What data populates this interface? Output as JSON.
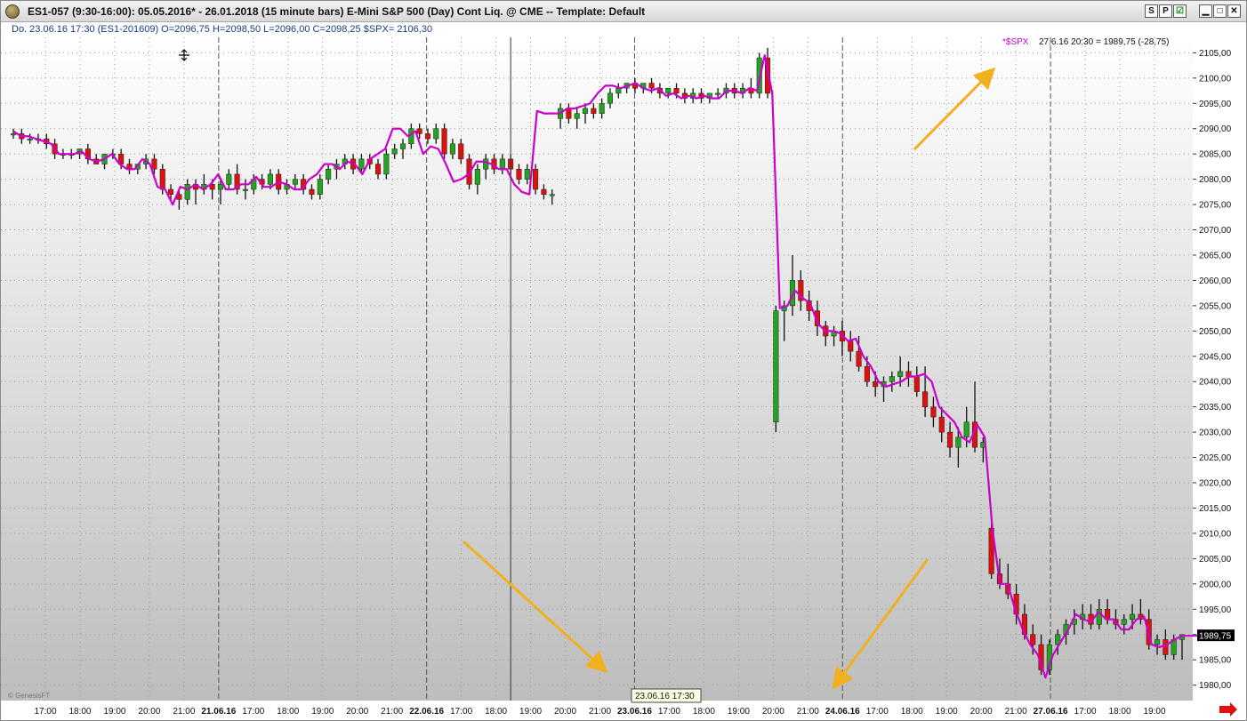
{
  "window": {
    "title": "ES1-057 (9:30-16:00):  05.05.2016* - 26.01.2018  (15 minute bars)   E-Mini S&P 500 (Day) Cont Liq. @ CME  --  Template: Default",
    "buttons": [
      "S",
      "P",
      "☑"
    ]
  },
  "infobar": {
    "text": "Do.   23.06.16 17:30 (ES1-201609)  O=2096,75  H=2098,50  L=2096,00  C=2098,25  $SPX= 2106,30"
  },
  "overlay": {
    "spx_label": "*$SPX",
    "spx_readout": "27.6.16 20:30 = 1989,75 (-28,75)",
    "last_price": "1989,75",
    "cursor_time": "23.06.16 17:30",
    "watermark": "© GenesisFT"
  },
  "colors": {
    "up_candle": "#22a322",
    "down_candle": "#dd1111",
    "spx_line": "#cc00cc",
    "arrow": "#f0b020",
    "axis_text": "#111111"
  },
  "chart_data": {
    "type": "line",
    "title": "",
    "xlabel": "",
    "ylabel": "",
    "ylim": [
      1978,
      2107
    ],
    "y_ticks": [
      "1980,00",
      "1985,00",
      "1990,00",
      "1995,00",
      "2000,00",
      "2005,00",
      "2010,00",
      "2015,00",
      "2020,00",
      "2025,00",
      "2030,00",
      "2035,00",
      "2040,00",
      "2045,00",
      "2050,00",
      "2055,00",
      "2060,00",
      "2065,00",
      "2070,00",
      "2075,00",
      "2080,00",
      "2085,00",
      "2090,00",
      "2095,00",
      "2100,00",
      "2105,00"
    ],
    "x_ticks": [
      {
        "label": "17:00",
        "bold": false
      },
      {
        "label": "18:00",
        "bold": false
      },
      {
        "label": "19:00",
        "bold": false
      },
      {
        "label": "20:00",
        "bold": false
      },
      {
        "label": "21:00",
        "bold": false
      },
      {
        "label": "21.06.16",
        "bold": true
      },
      {
        "label": "17:00",
        "bold": false
      },
      {
        "label": "18:00",
        "bold": false
      },
      {
        "label": "19:00",
        "bold": false
      },
      {
        "label": "20:00",
        "bold": false
      },
      {
        "label": "21:00",
        "bold": false
      },
      {
        "label": "22.06.16",
        "bold": true
      },
      {
        "label": "17:00",
        "bold": false
      },
      {
        "label": "18:00",
        "bold": false
      },
      {
        "label": "19:00",
        "bold": false
      },
      {
        "label": "20:00",
        "bold": false
      },
      {
        "label": "21:00",
        "bold": false
      },
      {
        "label": "23.06.16",
        "bold": true
      },
      {
        "label": "17:00",
        "bold": false
      },
      {
        "label": "18:00",
        "bold": false
      },
      {
        "label": "19:00",
        "bold": false
      },
      {
        "label": "20:00",
        "bold": false
      },
      {
        "label": "21:00",
        "bold": false
      },
      {
        "label": "24.06.16",
        "bold": true
      },
      {
        "label": "17:00",
        "bold": false
      },
      {
        "label": "18:00",
        "bold": false
      },
      {
        "label": "19:00",
        "bold": false
      },
      {
        "label": "20:00",
        "bold": false
      },
      {
        "label": "21:00",
        "bold": false
      },
      {
        "label": "27.06.16",
        "bold": true
      },
      {
        "label": "17:00",
        "bold": false
      },
      {
        "label": "18:00",
        "bold": false
      },
      {
        "label": "19:00",
        "bold": false
      }
    ],
    "cursor_index": 60,
    "series": [
      {
        "name": "*$SPX",
        "values": [
          2089.5,
          2088.5,
          2088.5,
          2088,
          2087.5,
          2087,
          2085,
          2085,
          2085,
          2085.5,
          2084,
          2083.5,
          2084,
          2085,
          2083,
          2082,
          2082,
          2084,
          2083,
          2078.5,
          2078,
          2075,
          2078.5,
          2078,
          2079,
          2078,
          2079,
          2081,
          2078,
          2078,
          2079,
          2079,
          2080.5,
          2078.5,
          2078.5,
          2079.5,
          2079,
          2078,
          2078,
          2080,
          2081,
          2083,
          2083,
          2082,
          2083.5,
          2083,
          2081,
          2084,
          2085,
          2086,
          2090,
          2090,
          2088.5,
          2089.5,
          2085,
          2086.5,
          2086,
          2083,
          2079.5,
          2080,
          2081,
          2083.5,
          2083.5,
          2083,
          2082,
          2082,
          2079,
          2077.5,
          2077,
          2093.5,
          2093,
          2093,
          2093,
          2094,
          2094,
          2094.5,
          2095,
          2097,
          2098.5,
          2098.5,
          2098,
          2098.5,
          2099,
          2098,
          2097.5,
          2098,
          2096.5,
          2097,
          2096,
          2096.5,
          2096,
          2096.5,
          2096,
          2096,
          2097.5,
          2097.5,
          2097,
          2098,
          2097.5,
          2104.5,
          2097,
          2054.5,
          2055,
          2058,
          2056.5,
          2055.5,
          2051.5,
          2050,
          2050,
          2049.5,
          2048,
          2048.5,
          2045,
          2043,
          2040,
          2039,
          2039.5,
          2040,
          2041,
          2041,
          2041.5,
          2040,
          2035,
          2033.5,
          2032,
          2029,
          2028,
          2031.5,
          2029,
          2011,
          2000,
          2000,
          1995,
          1991,
          1988,
          1986,
          1981.5,
          1986,
          1988.5,
          1991,
          1994,
          1993,
          1992.5,
          1994.5,
          1993,
          1993,
          1991,
          1991,
          1993,
          1993.5,
          1988,
          1987.5,
          1988,
          1989,
          1989.75
        ]
      }
    ],
    "candles": [
      [
        2089,
        2090,
        2088,
        2089
      ],
      [
        2089,
        2090,
        2087,
        2088
      ],
      [
        2088,
        2089,
        2087,
        2088
      ],
      [
        2088,
        2089,
        2087,
        2088
      ],
      [
        2088,
        2089,
        2086,
        2087
      ],
      [
        2087,
        2088,
        2084,
        2085
      ],
      [
        2085,
        2086,
        2084,
        2085
      ],
      [
        2085,
        2086,
        2084,
        2085
      ],
      [
        2085,
        2086,
        2084,
        2086
      ],
      [
        2086,
        2087,
        2083,
        2084
      ],
      [
        2084,
        2085,
        2083,
        2083
      ],
      [
        2083,
        2085,
        2082,
        2085
      ],
      [
        2085,
        2086,
        2084,
        2085
      ],
      [
        2085,
        2086,
        2082,
        2083
      ],
      [
        2083,
        2084,
        2081,
        2082
      ],
      [
        2082,
        2083,
        2081,
        2083
      ],
      [
        2083,
        2085,
        2082,
        2084
      ],
      [
        2084,
        2085,
        2081,
        2082
      ],
      [
        2082,
        2083,
        2077,
        2078
      ],
      [
        2078,
        2079,
        2076,
        2077
      ],
      [
        2077,
        2078,
        2074,
        2076
      ],
      [
        2076,
        2080,
        2075,
        2079
      ],
      [
        2079,
        2080,
        2075,
        2078
      ],
      [
        2078,
        2081,
        2077,
        2079
      ],
      [
        2079,
        2080,
        2076,
        2078
      ],
      [
        2078,
        2080,
        2075,
        2079
      ],
      [
        2079,
        2082,
        2078,
        2081
      ],
      [
        2081,
        2083,
        2077,
        2078
      ],
      [
        2078,
        2080,
        2076,
        2078
      ],
      [
        2078,
        2081,
        2077,
        2080
      ],
      [
        2080,
        2081,
        2078,
        2079
      ],
      [
        2079,
        2082,
        2078,
        2081
      ],
      [
        2081,
        2082,
        2077,
        2078
      ],
      [
        2078,
        2080,
        2077,
        2079
      ],
      [
        2079,
        2081,
        2078,
        2080
      ],
      [
        2080,
        2081,
        2077,
        2078
      ],
      [
        2078,
        2079,
        2076,
        2077
      ],
      [
        2077,
        2081,
        2076,
        2080
      ],
      [
        2080,
        2083,
        2079,
        2082
      ],
      [
        2082,
        2084,
        2080,
        2083
      ],
      [
        2083,
        2085,
        2082,
        2084
      ],
      [
        2084,
        2085,
        2081,
        2082
      ],
      [
        2082,
        2085,
        2081,
        2084
      ],
      [
        2084,
        2085,
        2082,
        2083
      ],
      [
        2083,
        2084,
        2080,
        2081
      ],
      [
        2081,
        2086,
        2080,
        2085
      ],
      [
        2085,
        2087,
        2084,
        2086
      ],
      [
        2086,
        2088,
        2084,
        2087
      ],
      [
        2087,
        2091,
        2086,
        2090
      ],
      [
        2090,
        2091,
        2088,
        2089
      ],
      [
        2089,
        2090,
        2087,
        2088
      ],
      [
        2088,
        2091,
        2087,
        2090
      ],
      [
        2090,
        2091,
        2084,
        2085
      ],
      [
        2085,
        2088,
        2084,
        2087
      ],
      [
        2087,
        2088,
        2083,
        2084
      ],
      [
        2084,
        2085,
        2078,
        2079
      ],
      [
        2079,
        2083,
        2077,
        2082
      ],
      [
        2082,
        2085,
        2080,
        2084
      ],
      [
        2084,
        2085,
        2081,
        2082
      ],
      [
        2082,
        2085,
        2081,
        2084
      ],
      [
        2084,
        2085,
        2081,
        2082
      ],
      [
        2082,
        2083,
        2079,
        2080
      ],
      [
        2080,
        2083,
        2079,
        2082
      ],
      [
        2082,
        2083,
        2077,
        2078
      ],
      [
        2078,
        2079,
        2076,
        2077
      ],
      [
        2077,
        2078,
        2075,
        2077
      ],
      [
        2092,
        2095,
        2090,
        2094
      ],
      [
        2094,
        2095,
        2091,
        2092
      ],
      [
        2092,
        2094,
        2090,
        2093
      ],
      [
        2093,
        2095,
        2091,
        2094
      ],
      [
        2094,
        2095,
        2092,
        2093
      ],
      [
        2093,
        2096,
        2092,
        2095
      ],
      [
        2095,
        2098,
        2094,
        2097
      ],
      [
        2097,
        2099,
        2096,
        2098
      ],
      [
        2098,
        2099,
        2097,
        2099
      ],
      [
        2099,
        2100,
        2097,
        2098
      ],
      [
        2098,
        2099,
        2097,
        2099
      ],
      [
        2099,
        2100,
        2097,
        2098
      ],
      [
        2098,
        2099,
        2096,
        2097
      ],
      [
        2097,
        2098,
        2096,
        2098
      ],
      [
        2098,
        2099,
        2096,
        2097
      ],
      [
        2097,
        2098,
        2095,
        2096
      ],
      [
        2096,
        2098,
        2095,
        2097
      ],
      [
        2097,
        2098,
        2095,
        2096
      ],
      [
        2096,
        2097,
        2095,
        2097
      ],
      [
        2097,
        2098,
        2096,
        2097
      ],
      [
        2097,
        2099,
        2096,
        2098
      ],
      [
        2098,
        2099,
        2096,
        2097
      ],
      [
        2097,
        2099,
        2096,
        2098
      ],
      [
        2098,
        2100,
        2096,
        2097
      ],
      [
        2097,
        2105,
        2096,
        2104
      ],
      [
        2104,
        2106,
        2096,
        2097
      ],
      [
        2032,
        2055,
        2030,
        2054
      ],
      [
        2054,
        2056,
        2048,
        2055
      ],
      [
        2055,
        2065,
        2053,
        2060
      ],
      [
        2060,
        2062,
        2054,
        2056
      ],
      [
        2056,
        2058,
        2052,
        2054
      ],
      [
        2054,
        2056,
        2049,
        2051
      ],
      [
        2051,
        2052,
        2047,
        2049
      ],
      [
        2049,
        2051,
        2047,
        2050
      ],
      [
        2050,
        2052,
        2045,
        2048
      ],
      [
        2048,
        2050,
        2044,
        2046
      ],
      [
        2046,
        2049,
        2042,
        2043
      ],
      [
        2043,
        2045,
        2039,
        2040
      ],
      [
        2040,
        2042,
        2037,
        2039
      ],
      [
        2039,
        2041,
        2036,
        2040
      ],
      [
        2040,
        2042,
        2038,
        2041
      ],
      [
        2041,
        2045,
        2039,
        2042
      ],
      [
        2042,
        2044,
        2039,
        2041
      ],
      [
        2041,
        2043,
        2037,
        2038
      ],
      [
        2038,
        2043,
        2033,
        2035
      ],
      [
        2035,
        2037,
        2031,
        2033
      ],
      [
        2033,
        2035,
        2028,
        2030
      ],
      [
        2030,
        2032,
        2025,
        2027
      ],
      [
        2027,
        2031,
        2023,
        2029
      ],
      [
        2029,
        2035,
        2027,
        2032
      ],
      [
        2032,
        2040,
        2026,
        2027
      ],
      [
        2027,
        2029,
        2024,
        2028
      ],
      [
        2011,
        2012,
        2001,
        2002
      ],
      [
        2002,
        2005,
        1999,
        2000
      ],
      [
        2000,
        2004,
        1997,
        1998
      ],
      [
        1998,
        2000,
        1992,
        1994
      ],
      [
        1994,
        1996,
        1989,
        1990
      ],
      [
        1990,
        1992,
        1986,
        1988
      ],
      [
        1988,
        1990,
        1982,
        1983
      ],
      [
        1983,
        1989,
        1982,
        1988
      ],
      [
        1988,
        1991,
        1986,
        1990
      ],
      [
        1990,
        1993,
        1988,
        1992
      ],
      [
        1992,
        1995,
        1990,
        1993
      ],
      [
        1993,
        1996,
        1991,
        1994
      ],
      [
        1994,
        1996,
        1991,
        1992
      ],
      [
        1992,
        1997,
        1991,
        1995
      ],
      [
        1995,
        1997,
        1992,
        1993
      ],
      [
        1993,
        1995,
        1991,
        1992
      ],
      [
        1992,
        1994,
        1990,
        1993
      ],
      [
        1993,
        1996,
        1991,
        1994
      ],
      [
        1994,
        1997,
        1992,
        1993
      ],
      [
        1993,
        1995,
        1987,
        1988
      ],
      [
        1988,
        1990,
        1986,
        1989
      ],
      [
        1989,
        1991,
        1985,
        1986
      ],
      [
        1986,
        1990,
        1985,
        1989
      ],
      [
        1989,
        1990,
        1985,
        1990
      ]
    ]
  }
}
